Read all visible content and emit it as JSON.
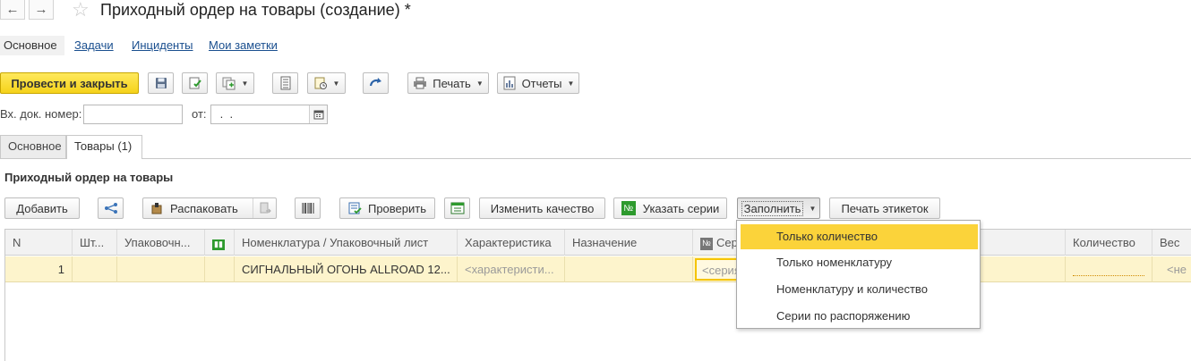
{
  "window": {
    "title": "Приходный ордер на товары (создание) *",
    "back_icon": "←",
    "forward_icon": "→",
    "star_icon": "☆"
  },
  "section_tabs": {
    "main": "Основное",
    "tasks": "Задачи",
    "incidents": "Инциденты",
    "notes": "Мои заметки"
  },
  "toolbar": {
    "post_close": "Провести и закрыть",
    "print": "Печать",
    "reports": "Отчеты"
  },
  "fields": {
    "in_doc_number_label": "Вх. док. номер:",
    "in_doc_number_value": "",
    "date_label": "от:",
    "date_value": " .  . "
  },
  "page_tabs": {
    "main": "Основное",
    "goods": "Товары (1)"
  },
  "group_title": "Приходный ордер на товары",
  "table_toolbar": {
    "add": "Добавить",
    "unpack": "Распаковать",
    "check": "Проверить",
    "change_quality": "Изменить качество",
    "set_series": "Указать серии",
    "fill": "Заполнить",
    "print_labels": "Печать этикеток"
  },
  "table": {
    "headers": {
      "n": "N",
      "pcs": "Шт...",
      "pack": "Упаковочн...",
      "nomenclature": "Номенклатура / Упаковочный лист",
      "characteristic": "Характеристика",
      "purpose": "Назначение",
      "series": "Сер",
      "quantity": "Количество",
      "weight": "Вес"
    },
    "rows": [
      {
        "n": "1",
        "pcs": "",
        "pack": "",
        "nomenclature": "СИГНАЛЬНЫЙ ОГОНЬ ALLROAD 12...",
        "characteristic": "<характеристи...",
        "purpose": "",
        "series": "<серия",
        "quantity": "",
        "weight": "<не"
      }
    ]
  },
  "fill_menu": {
    "items": [
      "Только количество",
      "Только номенклатуру",
      "Номенклатуру и количество",
      "Серии по распоряжению"
    ],
    "selected_index": 0
  },
  "colors": {
    "primary_button": "#f5d21a",
    "selected_row": "#fdf4cc",
    "menu_highlight": "#fbd33a",
    "link": "#1a4f8f"
  }
}
